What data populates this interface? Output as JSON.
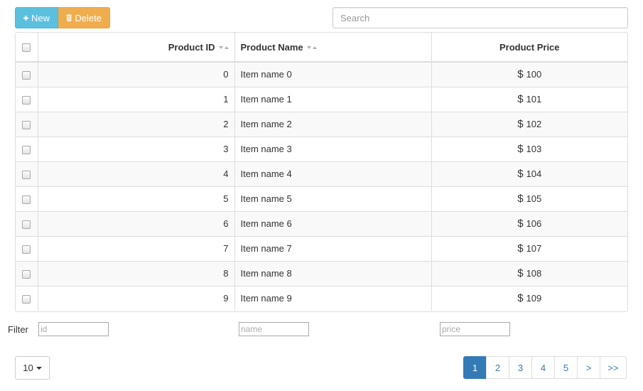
{
  "toolbar": {
    "new_label": "New",
    "delete_label": "Delete"
  },
  "search": {
    "placeholder": "Search",
    "value": ""
  },
  "table": {
    "headers": [
      "Product ID",
      "Product Name",
      "Product Price"
    ],
    "currency_symbol": "$",
    "rows": [
      {
        "id": "0",
        "name": "Item name 0",
        "price": "100"
      },
      {
        "id": "1",
        "name": "Item name 1",
        "price": "101"
      },
      {
        "id": "2",
        "name": "Item name 2",
        "price": "102"
      },
      {
        "id": "3",
        "name": "Item name 3",
        "price": "103"
      },
      {
        "id": "4",
        "name": "Item name 4",
        "price": "104"
      },
      {
        "id": "5",
        "name": "Item name 5",
        "price": "105"
      },
      {
        "id": "6",
        "name": "Item name 6",
        "price": "106"
      },
      {
        "id": "7",
        "name": "Item name 7",
        "price": "107"
      },
      {
        "id": "8",
        "name": "Item name 8",
        "price": "108"
      },
      {
        "id": "9",
        "name": "Item name 9",
        "price": "109"
      }
    ]
  },
  "filter": {
    "label": "Filter",
    "id_placeholder": "id",
    "name_placeholder": "name",
    "price_placeholder": "price"
  },
  "pagesize": {
    "value": "10"
  },
  "pagination": {
    "pages": [
      "1",
      "2",
      "3",
      "4",
      "5",
      ">",
      ">>"
    ],
    "active": "1"
  },
  "colors": {
    "new_button": "#5bc0de",
    "delete_button": "#f0ad4e",
    "active_page": "#337ab7",
    "link": "#337ab7"
  },
  "icons": {
    "new": "plus-icon",
    "delete": "trash-icon",
    "sort": "sort-icon",
    "pagesize": "caret-down-icon"
  }
}
